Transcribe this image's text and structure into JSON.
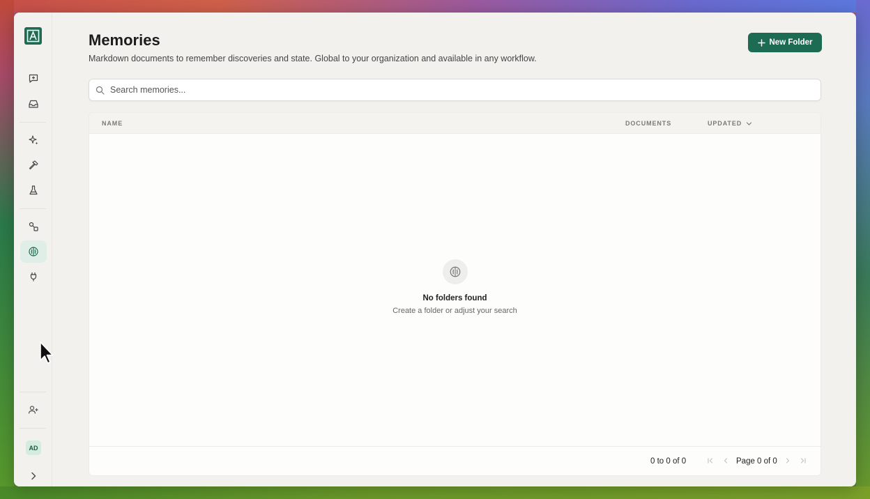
{
  "header": {
    "title": "Memories",
    "subtitle": "Markdown documents to remember discoveries and state. Global to your organization and available in any workflow.",
    "new_folder_label": "New Folder"
  },
  "search": {
    "placeholder": "Search memories...",
    "value": ""
  },
  "table": {
    "columns": [
      "NAME",
      "DOCUMENTS",
      "UPDATED"
    ]
  },
  "empty_state": {
    "title": "No folders found",
    "subtitle": "Create a folder or adjust your search"
  },
  "pagination": {
    "row_count": "0 to 0 of 0",
    "page_info": "Page 0 of 0"
  },
  "sidebar": {
    "user_initials": "AD",
    "items": [
      {
        "icon": "chat-plus-icon"
      },
      {
        "icon": "inbox-icon"
      },
      {
        "icon": "sparkles-icon"
      },
      {
        "icon": "hammer-icon"
      },
      {
        "icon": "flask-icon"
      },
      {
        "icon": "workflow-icon"
      },
      {
        "icon": "brain-icon",
        "active": true
      },
      {
        "icon": "plug-icon"
      },
      {
        "icon": "add-user-icon"
      },
      {
        "icon": "chevron-right-icon"
      }
    ]
  },
  "colors": {
    "accent": "#1c6b52",
    "active_bg": "#dfeee6",
    "window_bg": "#f2f1ed"
  }
}
